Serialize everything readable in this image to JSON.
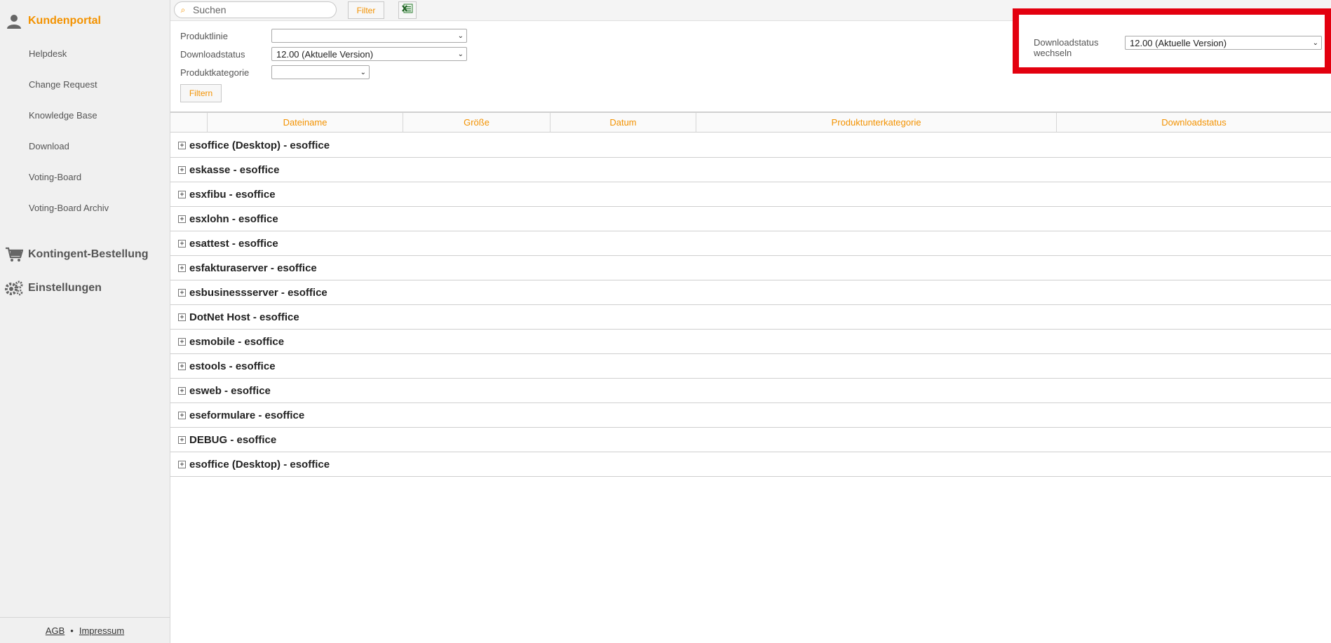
{
  "sidebar": {
    "portal_title": "Kundenportal",
    "items": [
      {
        "label": "Helpdesk"
      },
      {
        "label": "Change Request"
      },
      {
        "label": "Knowledge Base"
      },
      {
        "label": "Download"
      },
      {
        "label": "Voting-Board"
      },
      {
        "label": "Voting-Board Archiv"
      }
    ],
    "kontingent": "Kontingent-Bestellung",
    "einstellungen": "Einstellungen",
    "footer": {
      "agb": "AGB",
      "separator": "•",
      "impressum": "Impressum"
    }
  },
  "toolbar": {
    "search_placeholder": "Suchen",
    "filter_label": "Filter",
    "excel_icon": "excel-export-icon"
  },
  "filters": {
    "produktlinie_label": "Produktlinie",
    "produktlinie_value": "",
    "downloadstatus_label": "Downloadstatus",
    "downloadstatus_value": "12.00 (Aktuelle Version)",
    "produktkategorie_label": "Produktkategorie",
    "produktkategorie_value": "",
    "filtern_label": "Filtern"
  },
  "download_panel": {
    "label": "Downloadstatus wechseln",
    "value": "12.00 (Aktuelle Version)",
    "highlight_color": "#e3000f"
  },
  "table": {
    "columns": [
      "Dateiname",
      "Größe",
      "Datum",
      "Produktunterkategorie",
      "Downloadstatus"
    ],
    "rows": [
      "esoffice (Desktop) - esoffice",
      "eskasse - esoffice",
      "esxfibu - esoffice",
      "esxlohn - esoffice",
      "esattest - esoffice",
      "esfakturaserver - esoffice",
      "esbusinessserver - esoffice",
      "DotNet Host - esoffice",
      "esmobile - esoffice",
      "estools - esoffice",
      "esweb - esoffice",
      "eseformulare - esoffice",
      "DEBUG - esoffice",
      "esoffice (Desktop) - esoffice"
    ]
  },
  "colors": {
    "accent": "#f39200"
  }
}
